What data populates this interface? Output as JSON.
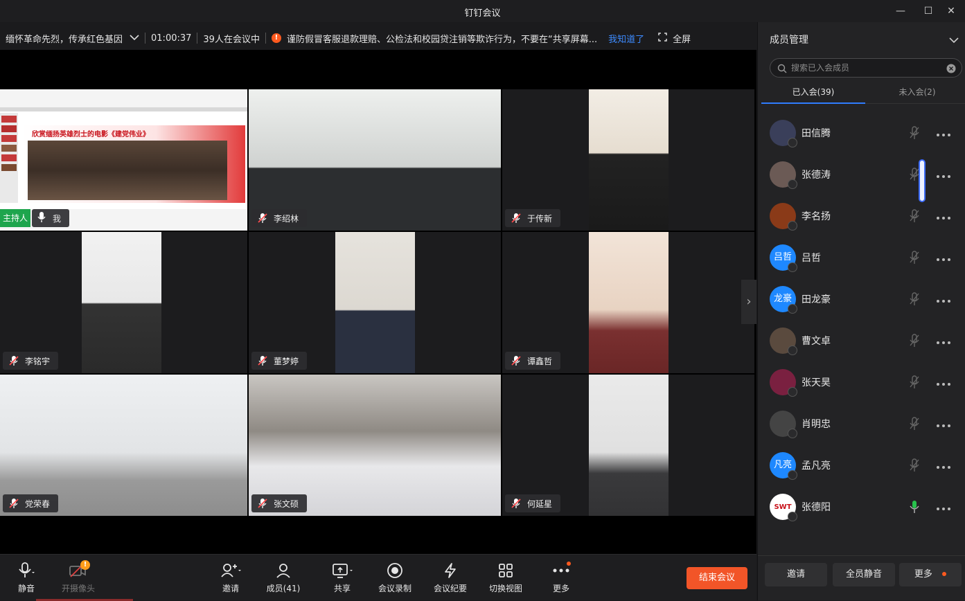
{
  "window": {
    "title": "钉钉会议",
    "minimize": "—",
    "maximize": "☐",
    "close": "✕"
  },
  "infobar": {
    "meeting_topic": "缅怀革命先烈，传承红色基因",
    "duration": "01:00:37",
    "attendee_count": "39人在会议中",
    "notice": "谨防假冒客服退款理赔、公检法和校园贷注销等欺诈行为，不要在“共享屏幕...",
    "notice_ack": "我知道了",
    "fullscreen": "全屏"
  },
  "slide": {
    "heading": "欣赏缅扬英雄烈士的电影《建党伟业》"
  },
  "tiles": [
    {
      "name": "我",
      "host_label": "主持人",
      "type": "screen-share"
    },
    {
      "name": "李绍林"
    },
    {
      "name": "于传新"
    },
    {
      "name": "李铭宇"
    },
    {
      "name": "董梦婷"
    },
    {
      "name": "谭鑫哲"
    },
    {
      "name": "党荣春"
    },
    {
      "name": "张文硕"
    },
    {
      "name": "何延星"
    }
  ],
  "toolbar": {
    "mute": "静音",
    "camera": "开摄像头",
    "camera_badge": "!",
    "invite": "邀请",
    "members": "成员(41)",
    "share": "共享",
    "record": "会议录制",
    "minutes": "会议纪要",
    "switch_view": "切换视图",
    "more": "更多",
    "end": "结束会议"
  },
  "panel": {
    "title": "成员管理",
    "search_placeholder": "搜索已入会成员",
    "tab_joined": "已入会(39)",
    "tab_not_joined": "未入会(2)",
    "members": [
      {
        "name": "田信腾",
        "avatar_text": "",
        "avatar_color": "#3a3f5a",
        "mic": "off"
      },
      {
        "name": "张德涛",
        "avatar_text": "",
        "avatar_color": "#6b5a55",
        "mic": "off"
      },
      {
        "name": "李名扬",
        "avatar_text": "",
        "avatar_color": "#8a3a18",
        "mic": "off"
      },
      {
        "name": "吕哲",
        "avatar_text": "吕哲",
        "avatar_color": "#1e88ff",
        "mic": "off"
      },
      {
        "name": "田龙豪",
        "avatar_text": "龙豪",
        "avatar_color": "#1e88ff",
        "mic": "off"
      },
      {
        "name": "曹文卓",
        "avatar_text": "",
        "avatar_color": "#5a4a3e",
        "mic": "off"
      },
      {
        "name": "张天昊",
        "avatar_text": "",
        "avatar_color": "#7a2040",
        "mic": "off"
      },
      {
        "name": "肖明忠",
        "avatar_text": "",
        "avatar_color": "#444",
        "mic": "off"
      },
      {
        "name": "孟凡亮",
        "avatar_text": "凡亮",
        "avatar_color": "#1e88ff",
        "mic": "off"
      },
      {
        "name": "张德阳",
        "avatar_text": "SWT",
        "avatar_color": "#ffffff",
        "mic": "on"
      }
    ],
    "footer_invite": "邀请",
    "footer_mute_all": "全员静音",
    "footer_more": "更多"
  },
  "colors": {
    "accent": "#2f7cff",
    "end_button": "#f25528",
    "host_badge": "#1ea54d",
    "mic_on": "#27c24c"
  }
}
